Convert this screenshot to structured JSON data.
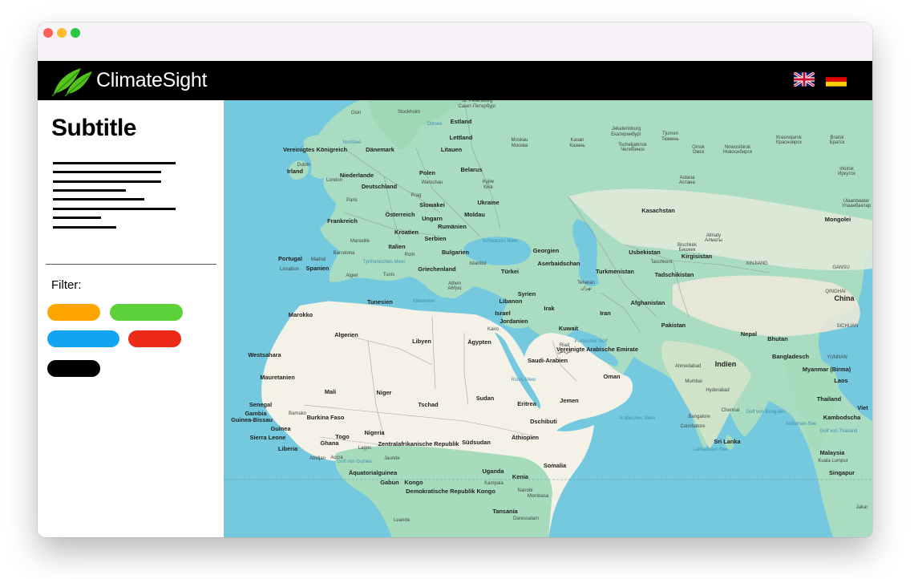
{
  "window": {
    "traffic_lights": {
      "close": "#ff5f57",
      "minimize": "#febc2e",
      "maximize": "#28c840"
    }
  },
  "header": {
    "title": "ClimateSight",
    "logo_icon": "leaf-icon",
    "logo_color": "#52c41a",
    "background": "#000000",
    "languages": [
      {
        "code": "en",
        "icon": "uk-flag-icon"
      },
      {
        "code": "de",
        "icon": "german-flag-icon"
      }
    ]
  },
  "sidebar": {
    "subtitle": "Subtitle",
    "filter_label": "Filter:",
    "filters": [
      {
        "color": "#ffa500"
      },
      {
        "color": "#5dd13a"
      },
      {
        "color": "#12a4f3"
      },
      {
        "color": "#ed2a17"
      },
      {
        "color": "#000000"
      }
    ]
  },
  "map": {
    "labels": {
      "oslo": "Oslo",
      "stockholm": "Stockholm",
      "stpete": "St. Petersburg",
      "spb_ru": "Санкт-Петербург",
      "estland": "Estland",
      "lettland": "Lettland",
      "litauen": "Litauen",
      "daenemark": "Dänemark",
      "nordsee": "Nordsee",
      "ostsee": "Ostsee",
      "uk": "Vereinigtes Königreich",
      "dublin": "Dublin",
      "irland": "Irland",
      "london": "London",
      "niederlande": "Niederlande",
      "deutschland": "Deutschland",
      "polen": "Polen",
      "warschau": "Warschau",
      "belarus": "Belarus",
      "moskau": "Moskau",
      "moskau_ru": "Москва",
      "kasan": "Kasan",
      "kasan_ru": "Казань",
      "jekaterinburg": "Jekaterinburg",
      "jekaterinburg_ru": "Екатеринбург",
      "tscheljabinsk": "Tscheljabinsk",
      "tscheljabinsk_ru": "Челябинск",
      "tjumen": "Tjumen",
      "tjumen_ru": "Тюмень",
      "omsk": "Omsk",
      "omsk_ru": "Омск",
      "nowosibirsk": "Nowosibirsk",
      "nowosibirsk_ru": "Новосибирск",
      "krasnojarsk": "Krasnojarsk",
      "krasnojarsk_ru": "Красноярск",
      "bratsk": "Bratsk",
      "bratsk_ru": "Братск",
      "irkutsk": "Irkutsk",
      "irkutsk_ru": "Иркутск",
      "kiew": "Kyjiw",
      "kiew_ru": "Київ",
      "ukraine": "Ukraine",
      "prag": "Prag",
      "slowakei": "Slowakei",
      "oesterreich": "Österreich",
      "ungarn": "Ungarn",
      "moldau": "Moldau",
      "paris": "Paris",
      "frankreich": "Frankreich",
      "rumaenien": "Rumänien",
      "kroatien": "Kroatien",
      "serbien": "Serbien",
      "marseille": "Marseille",
      "barcelona": "Barcelona",
      "madrid": "Madrid",
      "portugal": "Portugal",
      "lissabon": "Lissabon",
      "spanien": "Spanien",
      "italien": "Italien",
      "rom": "Rom",
      "bulgarien": "Bulgarien",
      "istanbul": "Istanbul",
      "schwarzes_meer": "Schwarzes Meer",
      "georgien": "Georgien",
      "aserbaidschan": "Aserbaidschan",
      "tuerkei": "Türkei",
      "griechenland": "Griechenland",
      "athen": "Athen",
      "athen_gr": "Αθήνα",
      "tyrrhenisches": "Tyrrhenisches Meer",
      "kasachstan": "Kasachstan",
      "astana": "Astana",
      "astana_kz": "Астана",
      "mongolei": "Mongolei",
      "ulaanbaatar": "Ulaanbaatar",
      "ulaanbaatar_mn": "Улаанбаатар",
      "usbekistan": "Usbekistan",
      "bischkek": "Bischkek",
      "bischkek_ru": "Бишкек",
      "almaty": "Almaty",
      "almaty_ru": "Алматы",
      "kirgisistan": "Kirgisistan",
      "taschkent": "Taschkent",
      "turkmenistan": "Turkmenistan",
      "tadschikistan": "Tadschikistan",
      "xinjiang": "XINJIANG",
      "teheran": "Teheran",
      "teheran_fa": "تهران",
      "afghanistan": "Afghanistan",
      "iran": "Iran",
      "pakistan": "Pakistan",
      "qinghai": "QINGHAI",
      "china": "China",
      "nepal": "Nepal",
      "bhutan": "Bhutan",
      "indien": "Indien",
      "bangladesch": "Bangladesch",
      "myanmar": "Myanmar (Birma)",
      "laos": "Laos",
      "thailand": "Thailand",
      "kambodscha": "Kambodscha",
      "vietnam": "Viet",
      "yunnan": "YUNNAN",
      "sichuan": "SICHUAN",
      "gansu": "GANSU",
      "hyderabad": "Hyderabad",
      "mumbai": "Mumbai",
      "ahmedabad": "Ahmedabad",
      "chennai": "Chennai",
      "bangalore": "Bangalore",
      "coimbatore": "Coimbatore",
      "sri_lanka": "Sri Lanka",
      "lakkadiven": "Lakkadiven-See",
      "golf_bengalen": "Golf von Bengalen",
      "andaman": "Andaman-See",
      "arabisches_meer": "Arabisches Meer",
      "malaysia": "Malaysia",
      "kuala_lumpur": "Kuala Lumpur",
      "singapur": "Singapur",
      "jakarta": "Jakar",
      "golf_thailand": "Golf von Thailand",
      "algier": "Algier",
      "tunis": "Tunis",
      "tunesien": "Tunesien",
      "marokko": "Marokko",
      "mittelmeer": "Mittelmeer",
      "algerien": "Algerien",
      "libyen": "Libyen",
      "aegypten": "Ägypten",
      "kairo": "Kairo",
      "syrien": "Syrien",
      "libanon": "Libanon",
      "israel": "Israel",
      "jordanien": "Jordanien",
      "irak": "Irak",
      "kuwait": "Kuwait",
      "riad": "Riad",
      "riad_ar": "الرياض",
      "saudi_arabien": "Saudi-Arabien",
      "persischer_golf": "Persischer Golf",
      "vae": "Vereinigte Arabische Emirate",
      "oman": "Oman",
      "jemen": "Jemen",
      "westsahara": "Westsahara",
      "mauretanien": "Mauretanien",
      "mali": "Mali",
      "niger": "Niger",
      "tschad": "Tschad",
      "sudan": "Sudan",
      "eritrea": "Eritrea",
      "dschibuti": "Dschibuti",
      "rotes_meer": "Rotes Meer",
      "senegal": "Senegal",
      "gambia": "Gambia",
      "bamako": "Bamako",
      "guinea_bissau": "Guinea-Bissau",
      "guinea": "Guinea",
      "burkina_faso": "Burkina Faso",
      "sierra_leone": "Sierra Leone",
      "liberia": "Liberia",
      "ghana": "Ghana",
      "togo": "Togo",
      "nigeria": "Nigeria",
      "lagos": "Lagos",
      "abidjan": "Abidjan",
      "accra": "Accra",
      "golf_guinea": "Golf von Guinea",
      "zar": "Zentralafrikanische Republik",
      "suedsudan": "Südsudan",
      "aethiopien": "Äthiopien",
      "somalia": "Somalia",
      "jaunde": "Jaunde",
      "aequatorialguinea": "Äquatorialguinea",
      "uganda": "Uganda",
      "kampala": "Kampala",
      "kenia": "Kenia",
      "nairobi": "Nairobi",
      "mombasa": "Mombasa",
      "gabun": "Gabun",
      "kongo": "Kongo",
      "drk": "Demokratische Republik Kongo",
      "tansania": "Tansania",
      "daressalam": "Daressalam",
      "luanda": "Luanda"
    }
  }
}
